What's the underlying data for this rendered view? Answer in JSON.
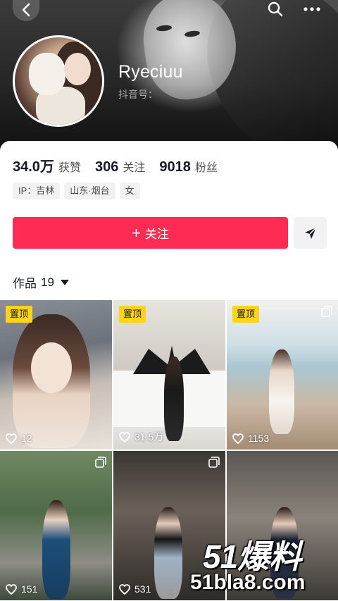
{
  "header": {
    "username": "Ryeciuu",
    "douyin_id_label": "抖音号：",
    "icons": {
      "back": "chevron-left-icon",
      "search": "search-icon",
      "more": "more-dots-icon"
    }
  },
  "stats": [
    {
      "value": "34.0万",
      "label": "获赞"
    },
    {
      "value": "306",
      "label": "关注"
    },
    {
      "value": "9018",
      "label": "粉丝"
    }
  ],
  "tags": [
    "IP：吉林",
    "山东·烟台",
    "女"
  ],
  "actions": {
    "follow_plus": "+",
    "follow_label": "关注",
    "share_icon": "send-icon"
  },
  "works": {
    "label": "作品",
    "count": "19"
  },
  "grid": [
    {
      "pinned": "置顶",
      "likes": "12"
    },
    {
      "pinned": "置顶",
      "likes": "31.5万"
    },
    {
      "pinned": "置顶",
      "likes": "1153"
    },
    {
      "pinned": "",
      "likes": "151"
    },
    {
      "pinned": "",
      "likes": "531"
    },
    {
      "pinned": "",
      "likes": ""
    }
  ],
  "watermark": {
    "top": "51爆料",
    "bottom": "51bla8.com"
  },
  "colors": {
    "accent": "#fe2c55",
    "pin": "#fdd41b"
  }
}
